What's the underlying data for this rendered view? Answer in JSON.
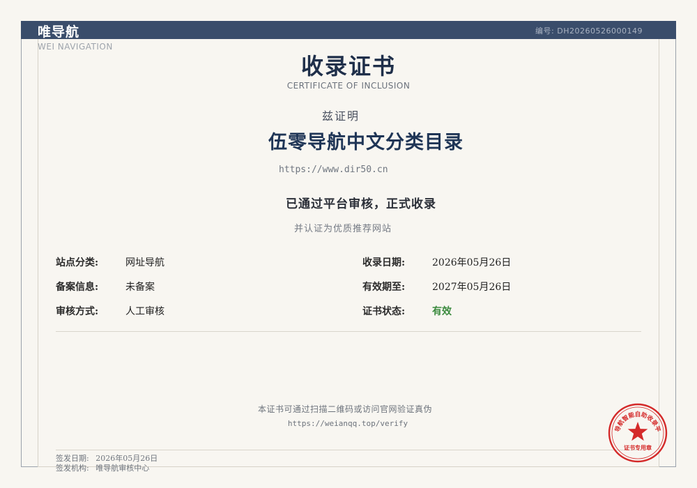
{
  "header": {
    "brand": "唯导航",
    "brand_en": "WEI NAVIGATION",
    "cert_no_label": "编号:",
    "cert_no": "DH20260526000149"
  },
  "certificate": {
    "title": "收录证书",
    "subtitle": "CERTIFICATE OF INCLUSION",
    "hereby": "兹证明",
    "site_name": "伍零导航中文分类目录",
    "site_url": "https://www.dir50.cn",
    "passed": "已通过平台审核，正式收录",
    "recognized": "并认证为优质推荐网站"
  },
  "info": {
    "category_label": "站点分类:",
    "category": "网址导航",
    "icp_label": "备案信息:",
    "icp": "未备案",
    "review_label": "审核方式:",
    "review": "人工审核",
    "date_label": "收录日期:",
    "date": "2026年05月26日",
    "valid_label": "有效期至:",
    "valid": "2027年05月26日",
    "status_label": "证书状态:",
    "status": "有效"
  },
  "verify": {
    "text": "本证书可通过扫描二维码或访问官网验证真伪",
    "url": "https://weianqq.top/verify"
  },
  "footer": {
    "issue_date_label": "签发日期:",
    "issue_date": "2026年05月26日",
    "issuer_label": "签发机构:",
    "issuer": "唯导航审核中心"
  },
  "seal": {
    "ring_text": "唯导航智能自助收录平台",
    "center_text": "证书专用章",
    "color": "#d42a2a"
  },
  "colors": {
    "header_bg": "#3a4d6b",
    "title": "#1f2f4a",
    "status_green": "#3b8a3e"
  }
}
